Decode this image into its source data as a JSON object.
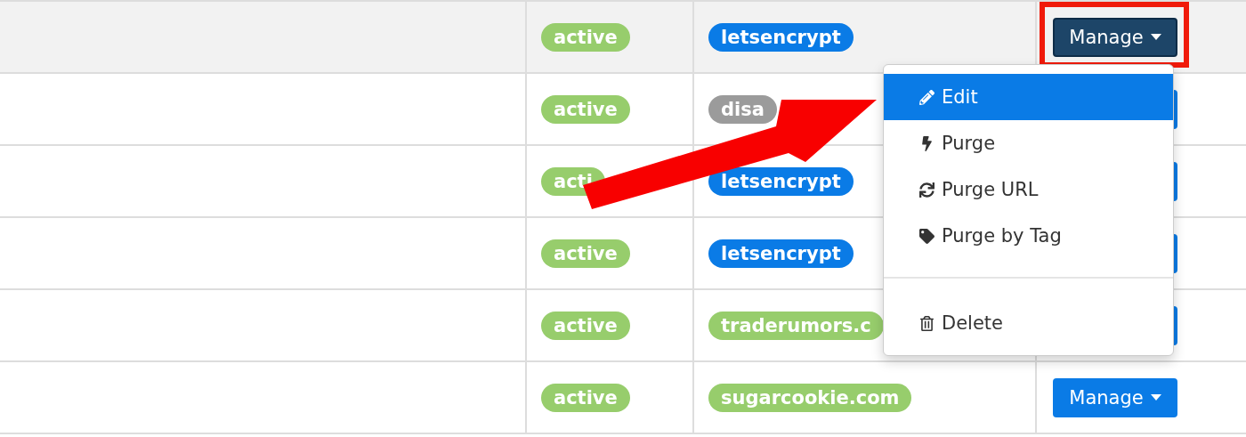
{
  "table": {
    "rows": [
      {
        "selected": true,
        "status": {
          "text": "active",
          "color": "#97cd6c"
        },
        "certificate": {
          "text": "letsencrypt",
          "color": "#0a7be6"
        },
        "manage": {
          "kind": "button",
          "label": "Manage",
          "open": true
        }
      },
      {
        "selected": false,
        "status": {
          "text": "active",
          "color": "#97cd6c"
        },
        "certificate": {
          "text": "disa",
          "color": "#9b9b9b"
        },
        "manage": {
          "kind": "covered"
        }
      },
      {
        "selected": false,
        "status": {
          "text": "acti",
          "color": "#97cd6c"
        },
        "certificate": {
          "text": "letsencrypt",
          "color": "#0a7be6"
        },
        "manage": {
          "kind": "covered"
        }
      },
      {
        "selected": false,
        "status": {
          "text": "active",
          "color": "#97cd6c"
        },
        "certificate": {
          "text": "letsencrypt",
          "color": "#0a7be6"
        },
        "manage": {
          "kind": "covered"
        }
      },
      {
        "selected": false,
        "status": {
          "text": "active",
          "color": "#97cd6c"
        },
        "certificate": {
          "text": "traderumors.c",
          "color": "#97cd6c"
        },
        "manage": {
          "kind": "covered"
        }
      },
      {
        "selected": false,
        "status": {
          "text": "active",
          "color": "#97cd6c"
        },
        "certificate": {
          "text": "sugarcookie.com",
          "color": "#97cd6c"
        },
        "manage": {
          "kind": "button",
          "label": "Manage",
          "open": false
        }
      }
    ]
  },
  "dropdown_menu": {
    "items": [
      {
        "kind": "edit",
        "label": "Edit",
        "selected": true
      },
      {
        "kind": "purge",
        "label": "Purge",
        "selected": false
      },
      {
        "kind": "url",
        "label": "Purge URL",
        "selected": false
      },
      {
        "kind": "tag",
        "label": "Purge by Tag",
        "selected": false
      },
      {
        "kind": "divider"
      },
      {
        "kind": "delete",
        "label": "Delete",
        "selected": false
      }
    ]
  },
  "annotation": {
    "highlight_box": true,
    "arrow": true
  }
}
